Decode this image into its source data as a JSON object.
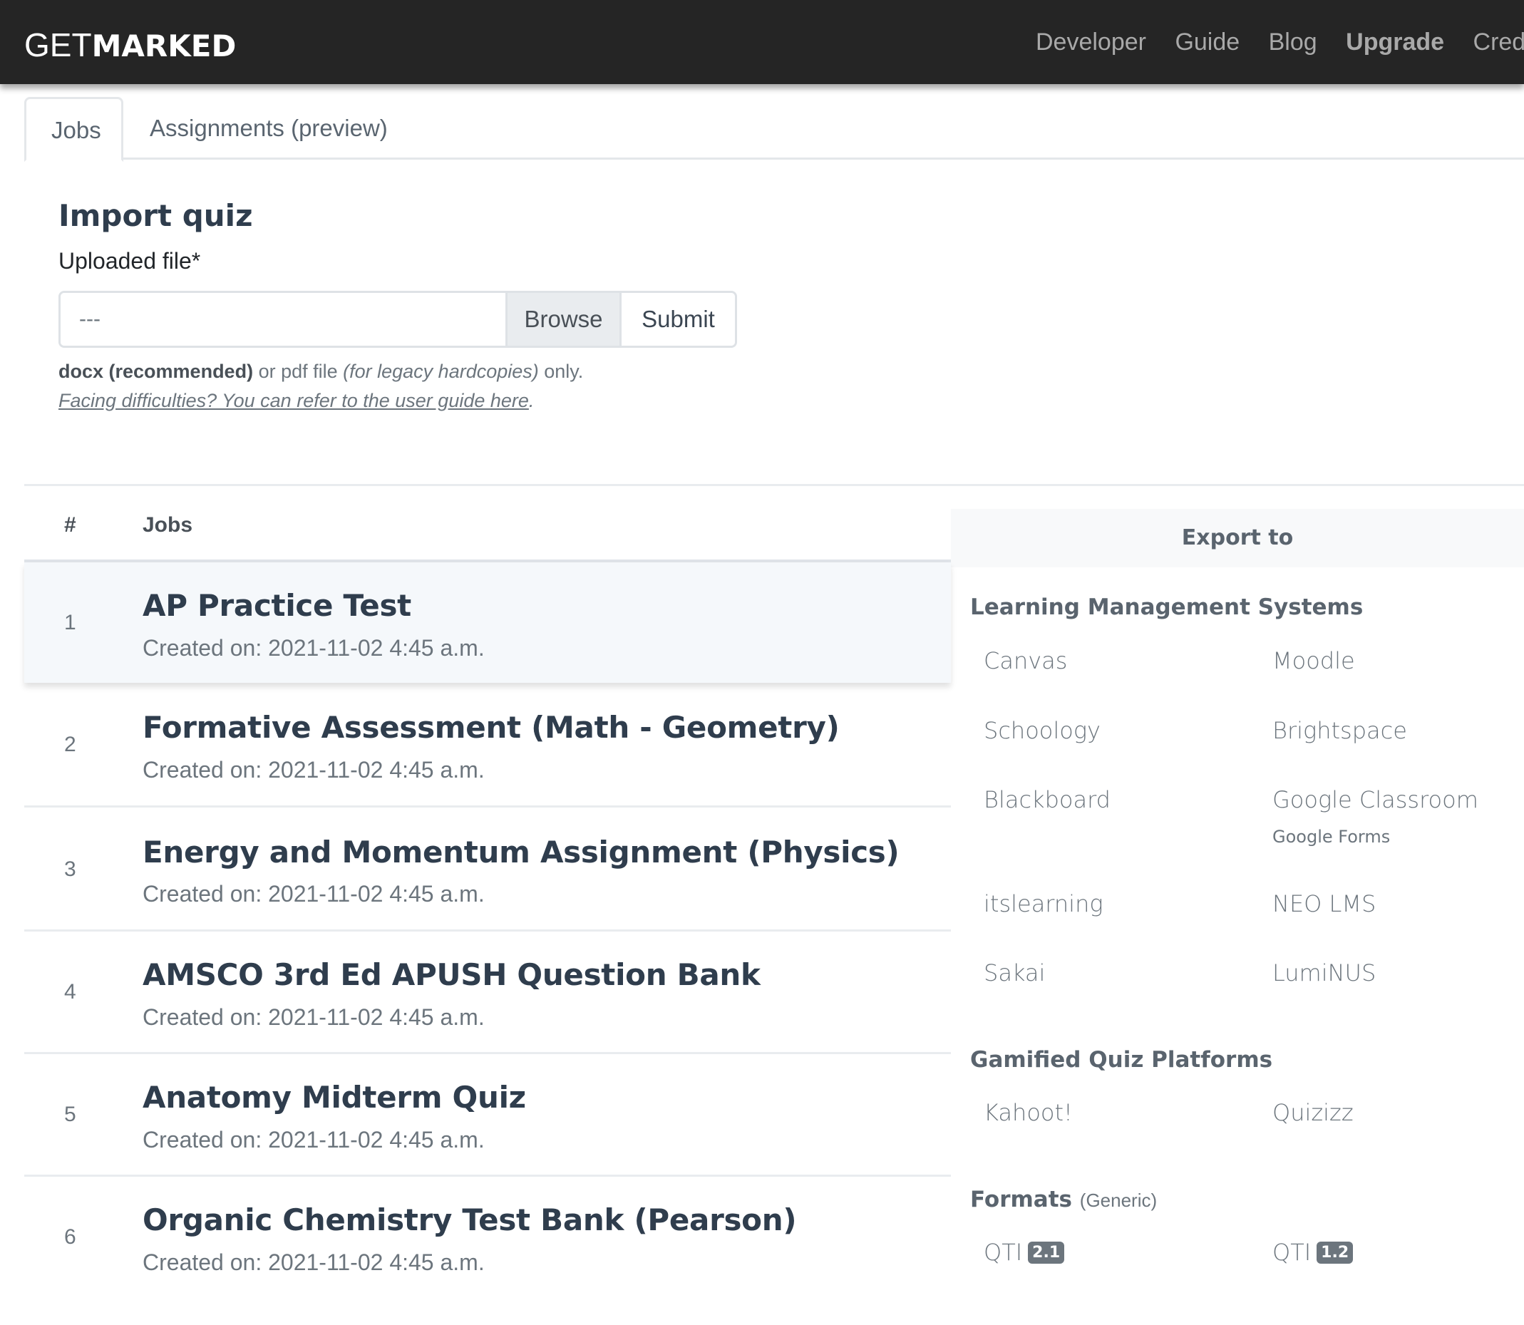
{
  "navbar": {
    "logo_light": "GET",
    "logo_bold": "MARKED",
    "links": [
      {
        "label": "Developer",
        "strong": false
      },
      {
        "label": "Guide",
        "strong": false
      },
      {
        "label": "Blog",
        "strong": false
      },
      {
        "label": "Upgrade",
        "strong": true
      },
      {
        "label": "Credits",
        "strong": false
      }
    ]
  },
  "tabs": [
    {
      "label": "Jobs",
      "active": true
    },
    {
      "label": "Assignments (preview)",
      "active": false
    }
  ],
  "import": {
    "title": "Import quiz",
    "file_label": "Uploaded file*",
    "file_value": "---",
    "browse_label": "Browse",
    "submit_label": "Submit",
    "help_bold": "docx (recommended)",
    "help_mid": " or pdf file ",
    "help_italic": "(for legacy hardcopies)",
    "help_end": " only.",
    "guide_link": "Facing difficulties? You can refer to the user guide here",
    "guide_end": "."
  },
  "table": {
    "col_num": "#",
    "col_jobs": "Jobs",
    "rows": [
      {
        "num": "1",
        "title": "AP Practice Test",
        "created": "Created on: 2021-11-02 4:45 a.m."
      },
      {
        "num": "2",
        "title": "Formative Assessment (Math - Geometry)",
        "created": "Created on: 2021-11-02 4:45 a.m."
      },
      {
        "num": "3",
        "title": "Energy and Momentum Assignment (Physics)",
        "created": "Created on: 2021-11-02 4:45 a.m."
      },
      {
        "num": "4",
        "title": "AMSCO 3rd Ed APUSH Question Bank",
        "created": "Created on: 2021-11-02 4:45 a.m."
      },
      {
        "num": "5",
        "title": "Anatomy Midterm Quiz",
        "created": "Created on: 2021-11-02 4:45 a.m."
      },
      {
        "num": "6",
        "title": "Organic Chemistry Test Bank (Pearson)",
        "created": "Created on: 2021-11-02 4:45 a.m."
      }
    ]
  },
  "export": {
    "header": "Export to",
    "lms_title": "Learning Management Systems",
    "lms": [
      "Canvas",
      "Moodle",
      "Schoology",
      "Brightspace",
      "Blackboard",
      "Google Classroom",
      "itslearning",
      "NEO LMS",
      "Sakai",
      "LumiNUS"
    ],
    "lms_sub": "Google Forms",
    "gamified_title": "Gamified Quiz Platforms",
    "gamified": [
      "Kahoot!",
      "Quizizz"
    ],
    "formats_title": "Formats",
    "formats_sub": "(Generic)",
    "formats": [
      {
        "label": "QTI",
        "version": "2.1"
      },
      {
        "label": "QTI",
        "version": "1.2"
      }
    ]
  }
}
